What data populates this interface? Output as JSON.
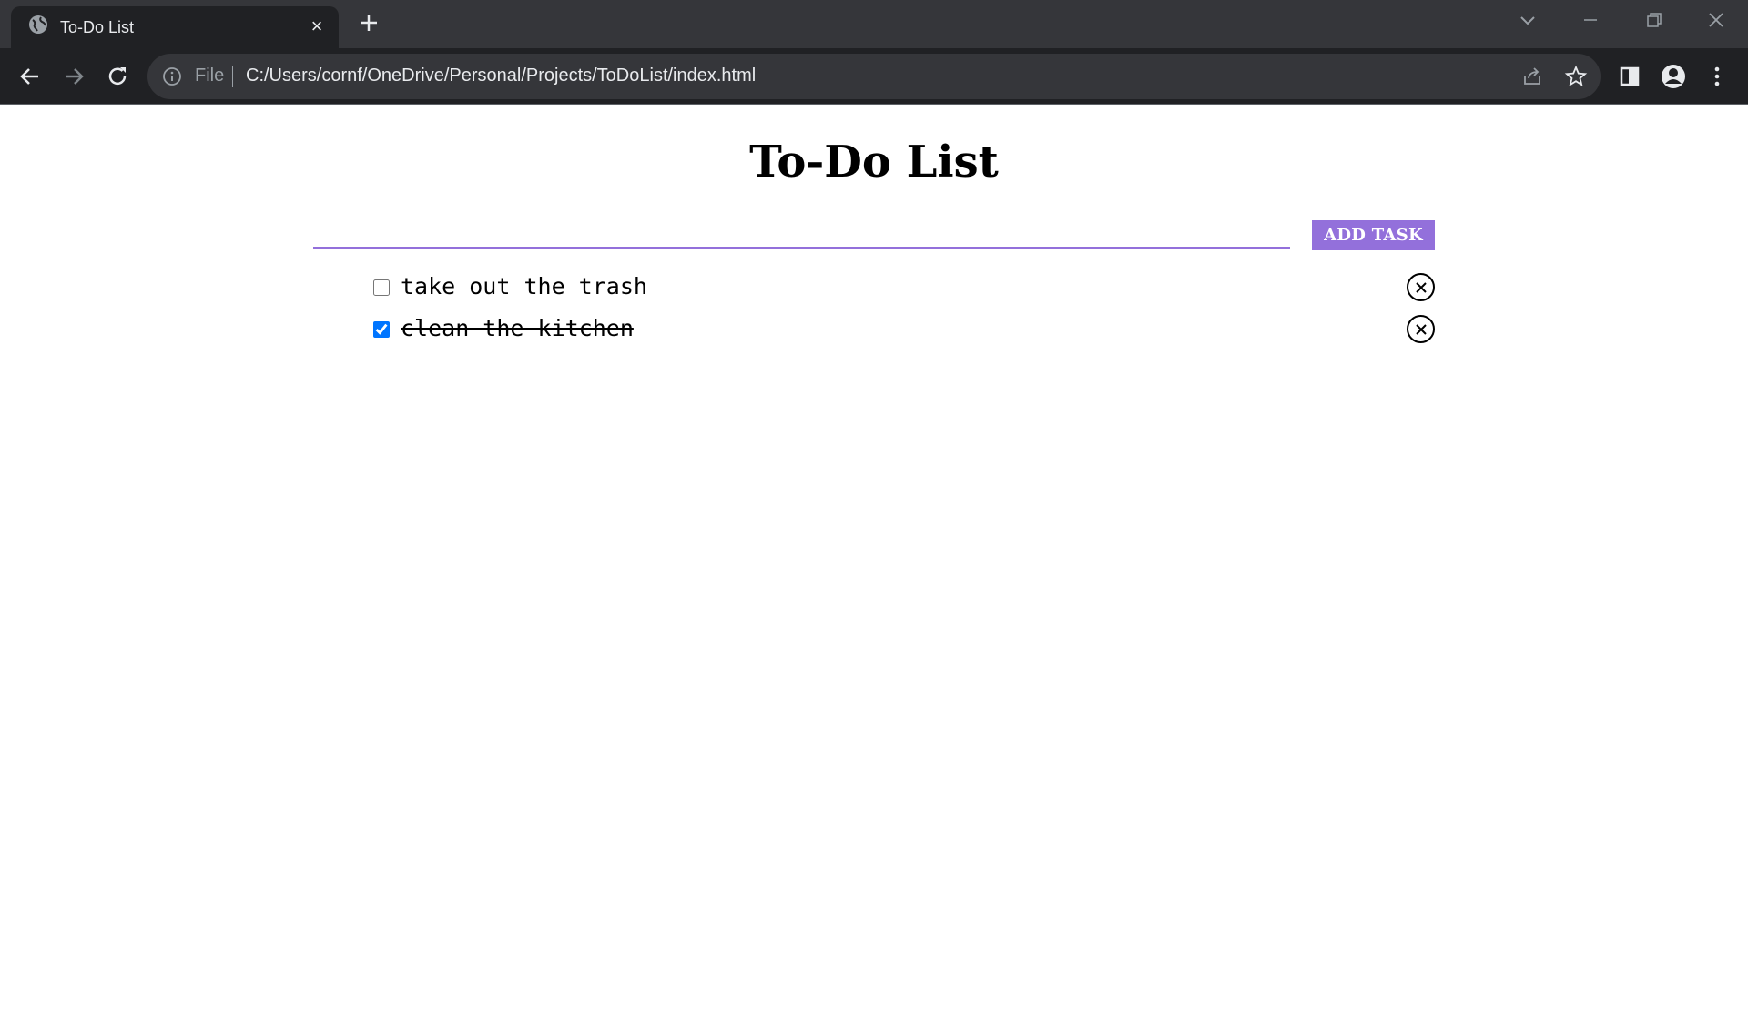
{
  "browser": {
    "tab": {
      "title": "To-Do List",
      "icon": "globe-icon",
      "close_label": "×"
    },
    "new_tab_icon": "plus-icon",
    "omnibox": {
      "scheme_label": "File",
      "url": "C:/Users/cornf/OneDrive/Personal/Projects/ToDoList/index.html"
    }
  },
  "page": {
    "title": "To-Do List",
    "input": {
      "value": "",
      "placeholder": ""
    },
    "add_button_label": "ADD TASK",
    "accent_color": "#9370db",
    "tasks": [
      {
        "text": "take out the trash",
        "completed": false
      },
      {
        "text": "clean the kitchen",
        "completed": true
      }
    ]
  }
}
